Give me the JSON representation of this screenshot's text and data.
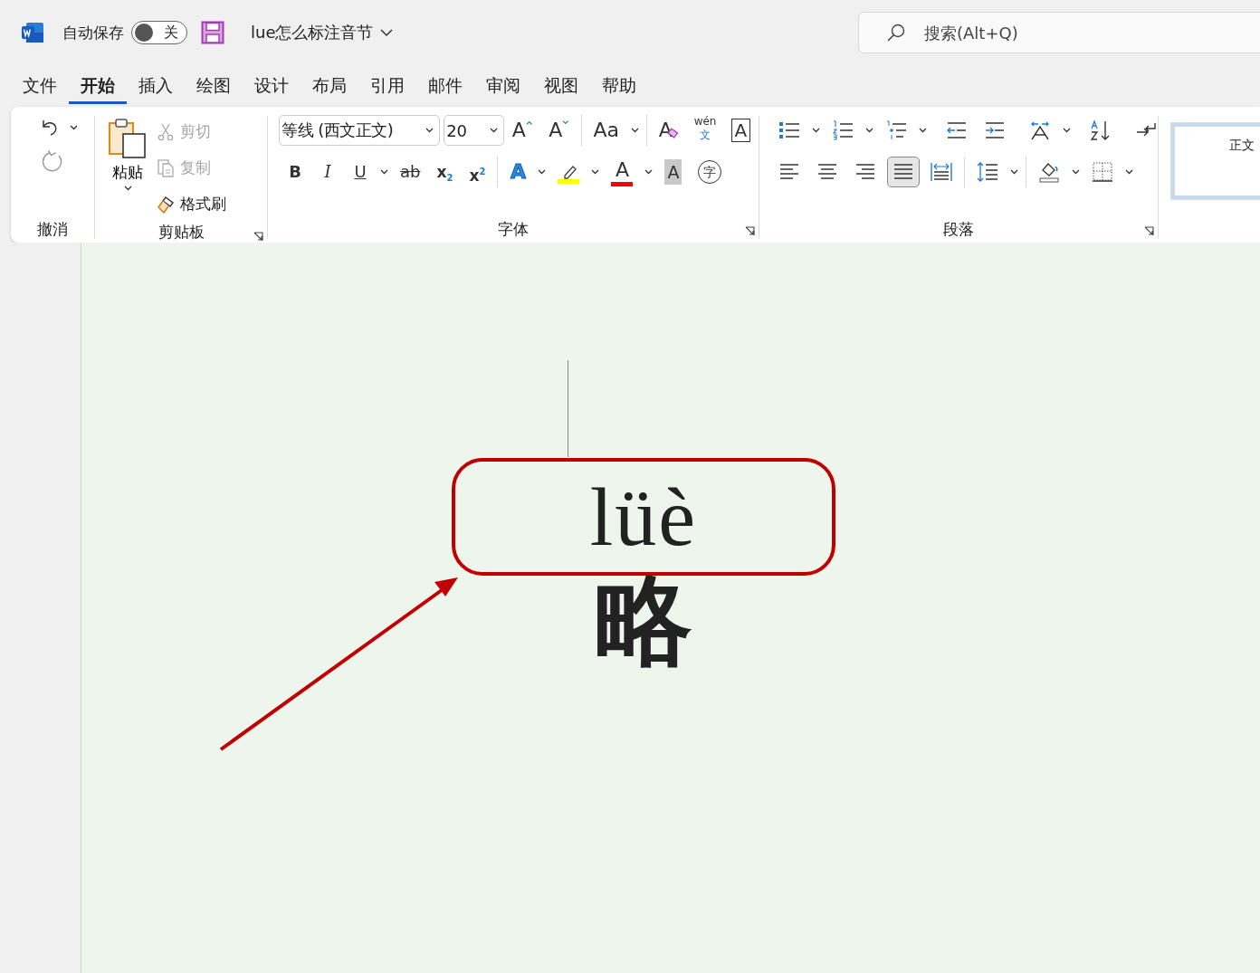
{
  "titlebar": {
    "autosave": {
      "label": "自动保存",
      "on": false,
      "state_label": "关"
    },
    "document_title": "lue怎么标注音节",
    "search": {
      "placeholder": "搜索(Alt+Q)"
    }
  },
  "tabs": [
    {
      "label": "文件",
      "selected": false
    },
    {
      "label": "开始",
      "selected": true
    },
    {
      "label": "插入",
      "selected": false
    },
    {
      "label": "绘图",
      "selected": false
    },
    {
      "label": "设计",
      "selected": false
    },
    {
      "label": "布局",
      "selected": false
    },
    {
      "label": "引用",
      "selected": false
    },
    {
      "label": "邮件",
      "selected": false
    },
    {
      "label": "审阅",
      "selected": false
    },
    {
      "label": "视图",
      "selected": false
    },
    {
      "label": "帮助",
      "selected": false
    }
  ],
  "ribbon": {
    "undo": {
      "label": "撤消"
    },
    "clipboard": {
      "label": "剪贴板",
      "paste": "粘贴",
      "items": [
        {
          "kind": "cut",
          "label": "剪切",
          "disabled": true
        },
        {
          "kind": "copy",
          "label": "复制",
          "disabled": true
        },
        {
          "kind": "painter",
          "label": "格式刷",
          "disabled": false
        }
      ]
    },
    "font": {
      "label": "字体",
      "font_name": "等线 (西文正文)",
      "font_size": "20",
      "row1": [
        {
          "kind": "grow",
          "glyph": "A"
        },
        {
          "kind": "shrink",
          "glyph": "A"
        },
        {
          "kind": "case",
          "glyph": "Aa"
        },
        {
          "kind": "clear",
          "glyph": "A"
        },
        {
          "kind": "phonetic",
          "glyph": "wén",
          "sub": "文"
        },
        {
          "kind": "boxed",
          "glyph": "A"
        }
      ],
      "row2": [
        {
          "kind": "bold",
          "glyph": "B"
        },
        {
          "kind": "italic",
          "glyph": "I"
        },
        {
          "kind": "underline",
          "glyph": "U"
        },
        {
          "kind": "strike",
          "glyph": "ab"
        },
        {
          "kind": "subscript",
          "glyph": "x$_{2}$"
        },
        {
          "kind": "superscript",
          "glyph": "x$^{2}$"
        },
        {
          "kind": "effect",
          "glyph": "A"
        },
        {
          "kind": "highlight",
          "color": "#ffff00"
        },
        {
          "kind": "fontcolor",
          "glyph": "A",
          "color": "#ff0000"
        },
        {
          "kind": "shading",
          "glyph": "A"
        },
        {
          "kind": "enclosed",
          "glyph": "字"
        }
      ]
    },
    "paragraph": {
      "label": "段落",
      "alignments": [
        {
          "kind": "left",
          "selected": false
        },
        {
          "kind": "center",
          "selected": false
        },
        {
          "kind": "right",
          "selected": false
        },
        {
          "kind": "justify",
          "selected": true
        },
        {
          "kind": "distributed",
          "selected": false
        }
      ]
    },
    "styles": {
      "items": [
        {
          "label": "正文",
          "selected": true
        }
      ]
    }
  },
  "document": {
    "pinyin": "lüè",
    "character": "略"
  }
}
